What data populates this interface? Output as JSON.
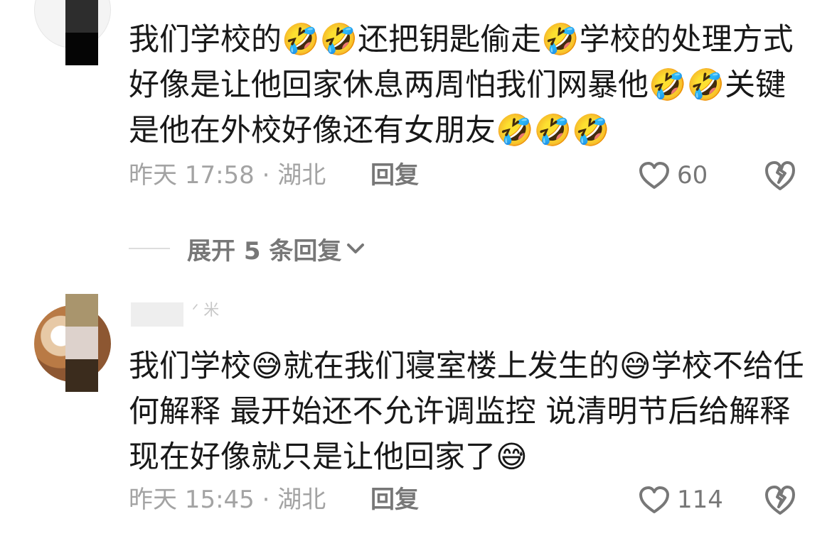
{
  "comments": [
    {
      "text": "我们学校的🤣🤣还把钥匙偷走🤣学校的处理方式好像是让他回家休息两周怕我们网暴他🤣🤣关键是他在外校好像还有女朋友🤣🤣🤣",
      "time_location": "昨天 17:58 · 湖北",
      "reply_label": "回复",
      "likes": "60"
    },
    {
      "username_fragment": "ᐟ 米",
      "text": "我们学校😅就在我们寝室楼上发生的😅学校不给任何解释 最开始还不允许调监控 说清明节后给解释现在好像就只是让他回家了😅",
      "time_location": "昨天 15:45 · 湖北",
      "reply_label": "回复",
      "likes": "114"
    }
  ],
  "expand_replies": {
    "label": "展开 5 条回复"
  },
  "icons": {
    "like": "heart-outline-icon",
    "dislike": "broken-heart-icon",
    "expand": "chevron-down-icon"
  },
  "colors": {
    "text": "#181818",
    "meta": "#a3a3a3",
    "action": "#777777",
    "divider": "#dddddd"
  }
}
